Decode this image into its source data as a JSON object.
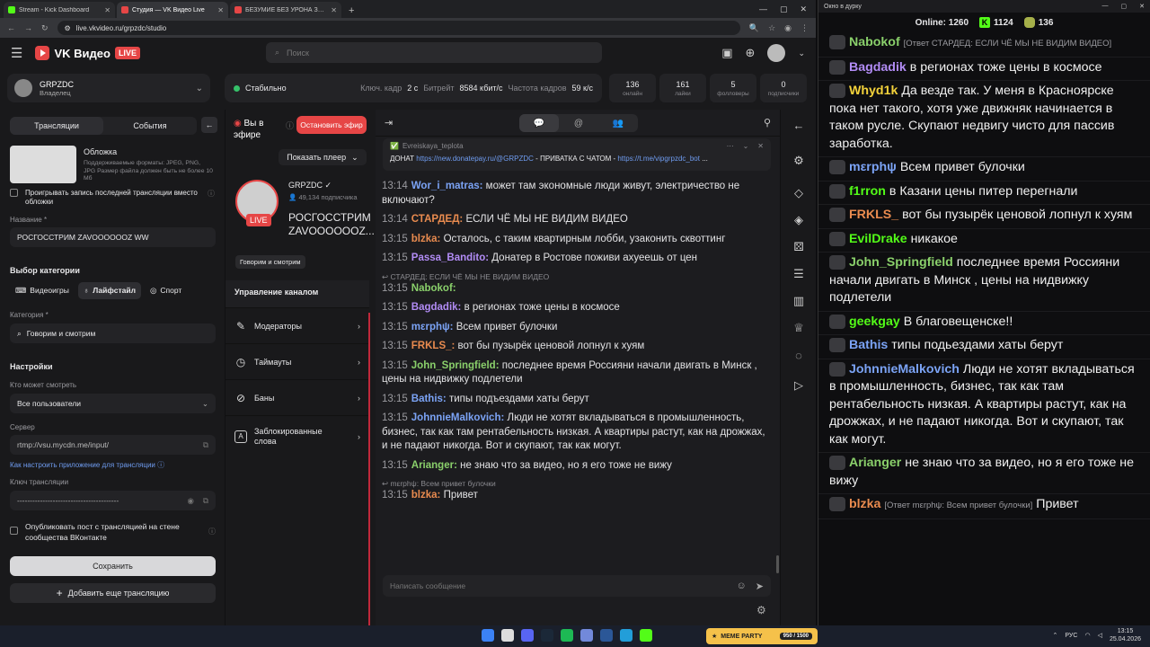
{
  "browser": {
    "tabs": [
      {
        "label": "Stream - Kick Dashboard",
        "color": "#53fc18"
      },
      {
        "label": "Студия — VK Видео Live",
        "color": "#e64646"
      },
      {
        "label": "БЕЗУМИЕ БЕЗ УРОНА ЗА 4 ЧАС",
        "color": "#e64646"
      }
    ],
    "url": "live.vkvideo.ru/grpzdc/studio"
  },
  "header": {
    "brand": "VK Видео",
    "live": "LIVE",
    "search_placeholder": "Поиск"
  },
  "channel": {
    "name": "GRPZDC",
    "role": "Владелец"
  },
  "status": {
    "state": "Стабильно",
    "keyframe_label": "Ключ. кадр",
    "keyframe": "2 с",
    "bitrate_label": "Битрейт",
    "bitrate": "8584 кбит/с",
    "fps_label": "Частота кадров",
    "fps": "59 к/с"
  },
  "stats": [
    {
      "value": "136",
      "label": "онлайн"
    },
    {
      "value": "161",
      "label": "лайки"
    },
    {
      "value": "5",
      "label": "фолловеры"
    },
    {
      "value": "0",
      "label": "подписчики"
    }
  ],
  "left": {
    "tab_streams": "Трансляции",
    "tab_events": "События",
    "cover_title": "Обложка",
    "cover_hint": "Поддерживаемые форматы: JPEG, PNG, JPG Размер файла должен быть не более 10 Мб",
    "replay_label": "Проигрывать запись последней трансляции вместо обложки",
    "name_label": "Название *",
    "name_value": "РОСГОССТРИМ ZAVOOOOOOZ WW",
    "category_section": "Выбор категории",
    "cat_games": "Видеоигры",
    "cat_lifestyle": "Лайфстайл",
    "cat_sport": "Спорт",
    "category_label": "Категория *",
    "category_value": "Говорим и смотрим",
    "settings": "Настройки",
    "who_label": "Кто может смотреть",
    "who_value": "Все пользователи",
    "server_label": "Сервер",
    "server_value": "rtmp://vsu.mycdn.me/input/",
    "howto": "Как настроить приложение для трансляции",
    "key_label": "Ключ трансляции",
    "key_value": "----------------------------------------",
    "publish_label": "Опубликовать пост с трансляцией на стене сообщества ВКонтакте",
    "save": "Сохранить",
    "add": "Добавить еще трансляцию"
  },
  "mid": {
    "on_air": "Вы в эфире",
    "stop": "Остановить эфир",
    "show_player": "Показать плеер",
    "channel": "GRPZDC",
    "subs": "49,134 подписчика",
    "title1": "РОСГОССТРИМ",
    "title2": "ZAVOOOOOOZ...",
    "tag": "Говорим и смотрим",
    "manage": "Управление каналом",
    "menu": [
      "Модераторы",
      "Таймауты",
      "Баны",
      "Заблокированные слова"
    ]
  },
  "chat": {
    "pin_user": "Evreiskaya_teplota",
    "pin_text_pre": "ДОНАТ ",
    "pin_link1": "https://new.donatepay.ru/@GRPZDC",
    "pin_mid": " - ПРИВАТКА С ЧАТОМ - ",
    "pin_link2": "https://t.me/vipgrpzdc_bot",
    "pin_end": " ...",
    "messages": [
      {
        "t": "13:14",
        "u": "Wor_i_matras:",
        "c": "#7ba3f5",
        "x": "может там экономные люди живут, электричество не включают?"
      },
      {
        "t": "13:14",
        "u": "СТАРДЕД:",
        "c": "#e98b4f",
        "x": "ЕСЛИ ЧЁ МЫ НЕ ВИДИМ ВИДЕО"
      },
      {
        "t": "13:15",
        "u": "blzka:",
        "c": "#e98b4f",
        "x": "Осталось, с таким квартирным лобби, узаконить сквоттинг"
      },
      {
        "t": "13:15",
        "u": "Passa_Bandito:",
        "c": "#b28cf5",
        "x": "Донатер в Ростове поживи ахуеешь от цен"
      },
      {
        "reply": "↩ СТАРДЕД: ЕСЛИ ЧЁ МЫ НЕ ВИДИМ ВИДЕО"
      },
      {
        "t": "13:15",
        "u": "Nabokof:",
        "c": "#8ad06b",
        "x": ""
      },
      {
        "t": "13:15",
        "u": "Bagdadik:",
        "c": "#b28cf5",
        "x": "в регионах тоже цены в космосе"
      },
      {
        "t": "13:15",
        "u": "mεrphψ:",
        "c": "#7ba3f5",
        "x": "Всем привет булочки"
      },
      {
        "t": "13:15",
        "u": "FRKLS_:",
        "c": "#e98b4f",
        "x": "вот бы пузырёк ценовой лопнул к хуям"
      },
      {
        "t": "13:15",
        "u": "John_Springfield:",
        "c": "#8ad06b",
        "x": "последнее время Россияни начали двигать в Минск , цены на нидвижку подлетели"
      },
      {
        "t": "13:15",
        "u": "Bathis:",
        "c": "#7ba3f5",
        "x": "типы подъездами хаты берут"
      },
      {
        "t": "13:15",
        "u": "JohnnieMalkovich:",
        "c": "#7ba3f5",
        "x": "Люди не хотят вкладываться в промышленность, бизнес, так как там рентабельность низкая. А квартиры растут, как на дрожжах, и не падают никогда. Вот и скупают, так как могут."
      },
      {
        "t": "13:15",
        "u": "Arianger:",
        "c": "#8ad06b",
        "x": "не знаю что за видео, но я его тоже не вижу"
      },
      {
        "reply": "↩ mεrphψ: Всем привет булочки"
      },
      {
        "t": "13:15",
        "u": "blzka:",
        "c": "#e98b4f",
        "x": "Привет"
      }
    ],
    "input_placeholder": "Написать сообщение"
  },
  "popout": {
    "title": "Окно в дурку",
    "online_label": "Online:",
    "online": "1260",
    "kick": "1124",
    "other": "136",
    "messages": [
      {
        "u": "Nabokof",
        "c": "#8ad06b",
        "rp": "[Ответ СТАРДЕД: ЕСЛИ ЧЁ МЫ НЕ ВИДИМ ВИДЕО]",
        "x": ""
      },
      {
        "u": "Bagdadik",
        "c": "#b28cf5",
        "x": "в регионах тоже цены в космосе"
      },
      {
        "u": "Whyd1k",
        "c": "#f5d33b",
        "x": "Да везде так. У меня в Красноярске пока нет такого, хотя уже движняк начинается в таком русле. Скупают недвигу чисто для пассив заработка."
      },
      {
        "u": "mεrphψ",
        "c": "#7ba3f5",
        "x": "Всем привет булочки"
      },
      {
        "u": "f1rron",
        "c": "#53fc18",
        "x": "в Казани цены питер перегнали"
      },
      {
        "u": "FRKLS_",
        "c": "#e98b4f",
        "x": "вот бы пузырёк ценовой лопнул к хуям"
      },
      {
        "u": "EvilDrake",
        "c": "#53fc18",
        "x": "никакое"
      },
      {
        "u": "John_Springfield",
        "c": "#8ad06b",
        "x": "последнее время Россияни начали двигать в Минск , цены на нидвижку подлетели"
      },
      {
        "u": "geekgay",
        "c": "#53fc18",
        "x": "В благовещенске!!"
      },
      {
        "u": "Bathis",
        "c": "#7ba3f5",
        "x": "типы подьездами хаты берут"
      },
      {
        "u": "JohnnieMalkovich",
        "c": "#7ba3f5",
        "x": "Люди не хотят вкладываться в промышленность, бизнес, так как там рентабельность низкая. А квартиры растут, как на дрожжах, и не падают никогда. Вот и скупают, так как могут."
      },
      {
        "u": "Arianger",
        "c": "#8ad06b",
        "x": "не знаю что за видео, но я его тоже не вижу"
      },
      {
        "u": "blzka",
        "c": "#e98b4f",
        "rp": "[Ответ mεrphψ: Всем привет булочки]",
        "x": "Привет"
      }
    ]
  },
  "taskbar": {
    "meme": "MEME PARTY",
    "meme_count": "950 / 1500",
    "lang": "РУС",
    "time": "13:15",
    "date": "25.04.2026"
  }
}
